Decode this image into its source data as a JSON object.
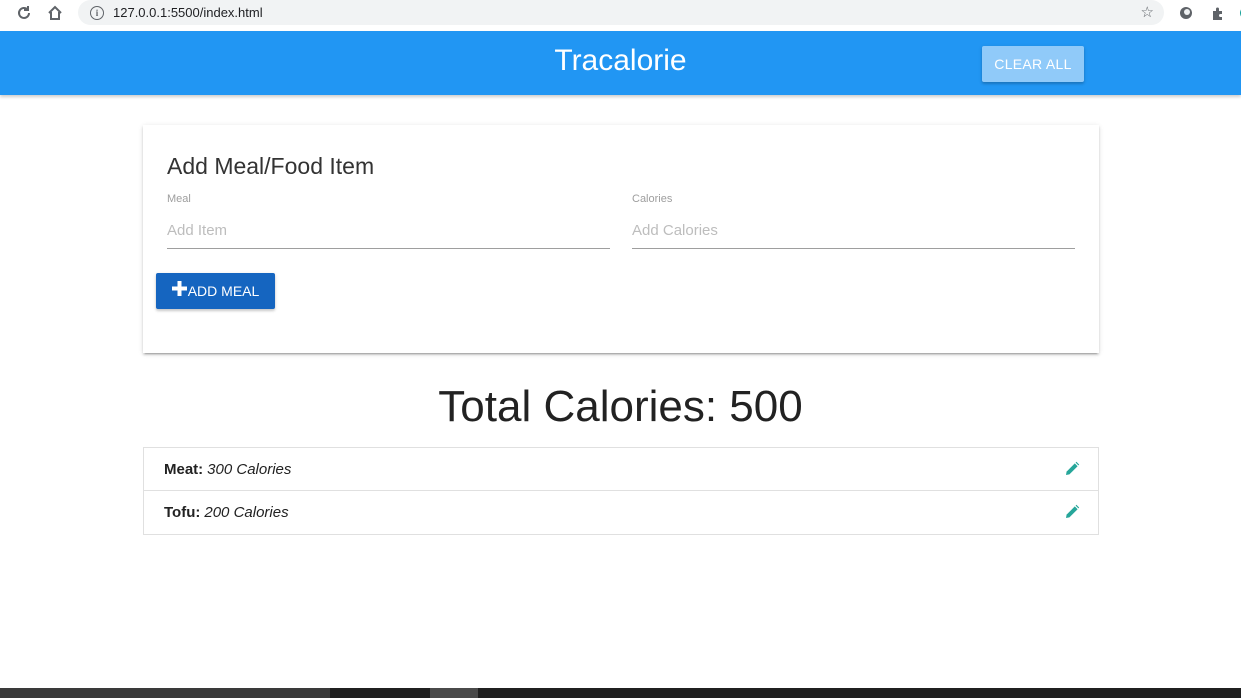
{
  "browser": {
    "url": "127.0.0.1:5500/index.html"
  },
  "header": {
    "brand": "Tracalorie",
    "clear_all_label": "CLEAR ALL"
  },
  "form": {
    "title": "Add Meal/Food Item",
    "meal_label": "Meal",
    "meal_placeholder": "Add Item",
    "meal_value": "",
    "calories_label": "Calories",
    "calories_placeholder": "Add Calories",
    "calories_value": "",
    "add_button_label": "ADD MEAL"
  },
  "total": {
    "text": "Total Calories: 500"
  },
  "items": [
    {
      "name": "Meat:",
      "calories": "300 Calories"
    },
    {
      "name": "Tofu:",
      "calories": "200 Calories"
    }
  ],
  "colors": {
    "header": "#2196f3",
    "add_button": "#1565c0",
    "clear_button": "#90caf9",
    "edit_icon": "#26a69a"
  },
  "icons": [
    "reload-icon",
    "home-icon",
    "info-icon",
    "star-icon",
    "extension-icon",
    "plus-icon",
    "pencil-icon"
  ]
}
